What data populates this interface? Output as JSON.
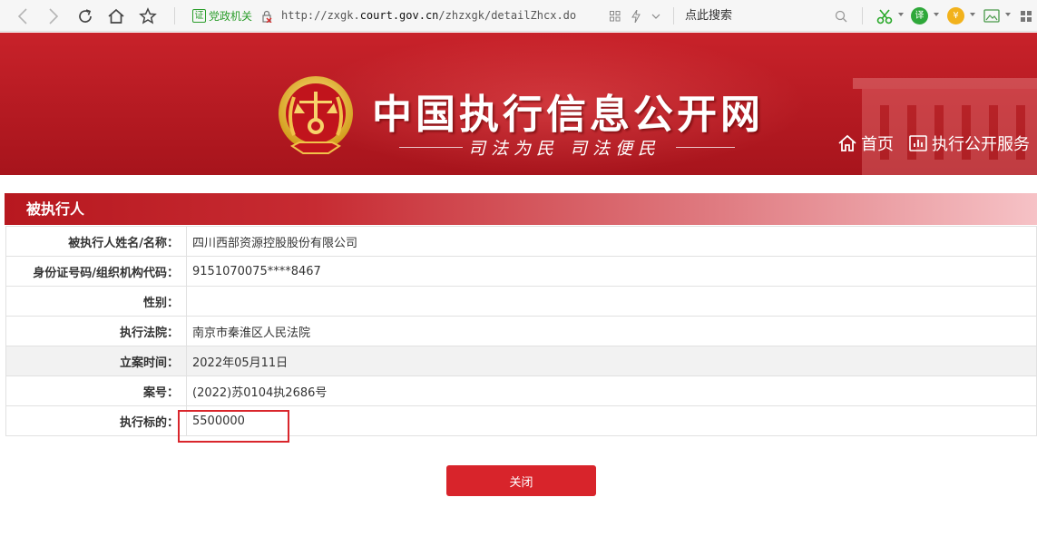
{
  "browser": {
    "gov_badge_char": "证",
    "gov_badge_label": "党政机关",
    "url_prefix": "http://zxgk.",
    "url_domain": "court.gov.cn",
    "url_path": "/zhzxgk/detailZhcx.do",
    "search_placeholder": "点此搜索",
    "ext_translate": "译",
    "ext_coin": "¥"
  },
  "banner": {
    "title": "中国执行信息公开网",
    "slogan": "司法为民   司法便民",
    "nav": {
      "home": "首页",
      "service": "执行公开服务"
    }
  },
  "section": {
    "title": "被执行人"
  },
  "details": [
    {
      "label": "被执行人姓名/名称：",
      "value": "四川西部资源控股股份有限公司"
    },
    {
      "label": "身份证号码/组织机构代码：",
      "value": "9151070075****8467"
    },
    {
      "label": "性别：",
      "value": ""
    },
    {
      "label": "执行法院：",
      "value": "南京市秦淮区人民法院"
    },
    {
      "label": "立案时间：",
      "value": "2022年05月11日"
    },
    {
      "label": "案号：",
      "value": "(2022)苏0104执2686号"
    },
    {
      "label": "执行标的：",
      "value": "5500000"
    }
  ],
  "actions": {
    "close_label": "关闭"
  },
  "colors": {
    "brand_red": "#c8222a",
    "button_red": "#d8242b",
    "gov_green": "#2a9d2a"
  }
}
